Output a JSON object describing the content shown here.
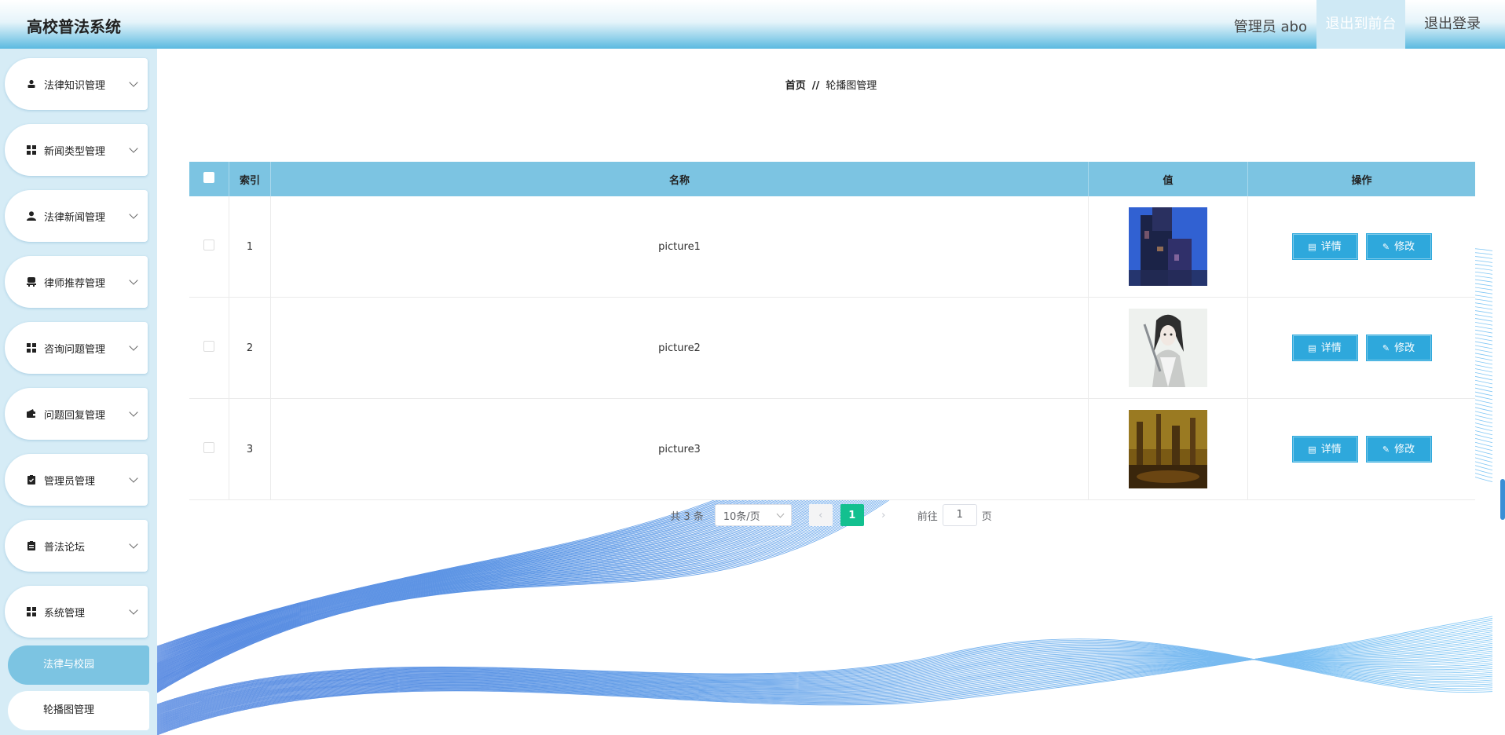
{
  "header": {
    "title": "高校普法系统",
    "admin_label": "管理员 abo",
    "back_button": "退出到前台",
    "logout_button": "退出登录"
  },
  "sidebar": {
    "items": [
      {
        "label": "法律知识管理",
        "icon": "person-icon"
      },
      {
        "label": "新闻类型管理",
        "icon": "grid-icon"
      },
      {
        "label": "法律新闻管理",
        "icon": "user-icon"
      },
      {
        "label": "律师推荐管理",
        "icon": "seat-icon"
      },
      {
        "label": "咨询问题管理",
        "icon": "grid-icon"
      },
      {
        "label": "问题回复管理",
        "icon": "wallet-icon"
      },
      {
        "label": "管理员管理",
        "icon": "clipboard-check-icon"
      },
      {
        "label": "普法论坛",
        "icon": "clipboard-icon"
      },
      {
        "label": "系统管理",
        "icon": "grid-icon"
      }
    ],
    "sub_items": [
      {
        "label": "法律与校园"
      },
      {
        "label": "轮播图管理"
      }
    ]
  },
  "breadcrumb": {
    "home": "首页",
    "separator": "//",
    "current": "轮播图管理"
  },
  "table": {
    "columns": [
      "索引",
      "名称",
      "值",
      "操作"
    ],
    "rows": [
      {
        "index": "1",
        "name": "picture1",
        "image": "dark-blue-city-thumbnail"
      },
      {
        "index": "2",
        "name": "picture2",
        "image": "anime-character-thumbnail"
      },
      {
        "index": "3",
        "name": "picture3",
        "image": "golden-ruins-thumbnail"
      }
    ],
    "detail_label": "详情",
    "edit_label": "修改"
  },
  "pagination": {
    "total": "共 3 条",
    "page_size": "10条/页",
    "current_page": "1",
    "goto_prefix": "前往",
    "goto_value": "1",
    "goto_suffix": "页"
  },
  "colors": {
    "accent": "#7cc4e2",
    "button": "#2ea8dc",
    "page_active": "#13c08f"
  }
}
